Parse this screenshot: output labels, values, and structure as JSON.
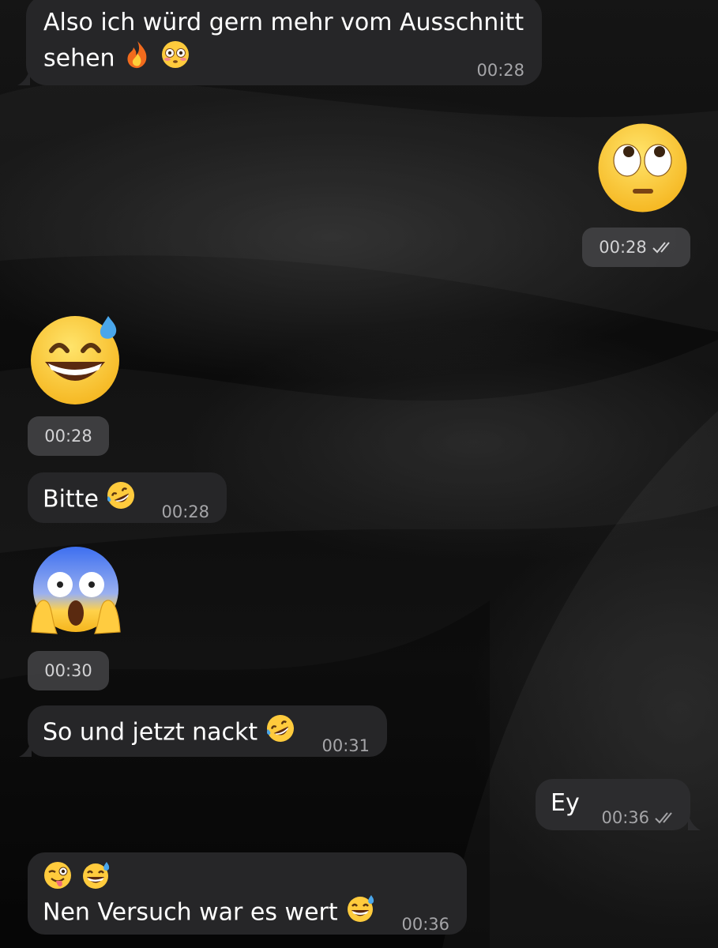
{
  "messages": [
    {
      "id": "m1",
      "direction": "incoming",
      "line1": "Also ich würd gern mehr vom Ausschnitt",
      "line2": "sehen",
      "emojis": [
        "fire",
        "flushed-face"
      ],
      "time": "00:28"
    },
    {
      "id": "m2",
      "direction": "outgoing",
      "type": "big-emoji",
      "emoji": "face-with-rolling-eyes",
      "time": "00:28",
      "status": "read"
    },
    {
      "id": "m3",
      "direction": "incoming",
      "type": "big-emoji",
      "emoji": "grinning-face-with-sweat",
      "time": "00:28"
    },
    {
      "id": "m4",
      "direction": "incoming",
      "text": "Bitte",
      "emojis": [
        "rolling-on-the-floor-laughing"
      ],
      "time": "00:28"
    },
    {
      "id": "m5",
      "direction": "incoming",
      "type": "big-emoji",
      "emoji": "face-screaming-in-fear",
      "time": "00:30"
    },
    {
      "id": "m6",
      "direction": "incoming",
      "text": "So und jetzt nackt",
      "emojis": [
        "rolling-on-the-floor-laughing"
      ],
      "time": "00:31"
    },
    {
      "id": "m7",
      "direction": "outgoing",
      "text": "Ey",
      "time": "00:36",
      "status": "read"
    },
    {
      "id": "m8",
      "direction": "incoming",
      "line0_emojis": [
        "winking-face-with-tongue",
        "grinning-face-with-sweat"
      ],
      "text": "Nen Versuch war es wert",
      "emojis": [
        "grinning-face-with-sweat"
      ],
      "time": "00:36"
    }
  ],
  "colors": {
    "incoming_bubble": "#262628",
    "outgoing_bubble": "#2c2c2e",
    "timestamp": "#a5a5a8",
    "background": "#0c0c0c"
  }
}
